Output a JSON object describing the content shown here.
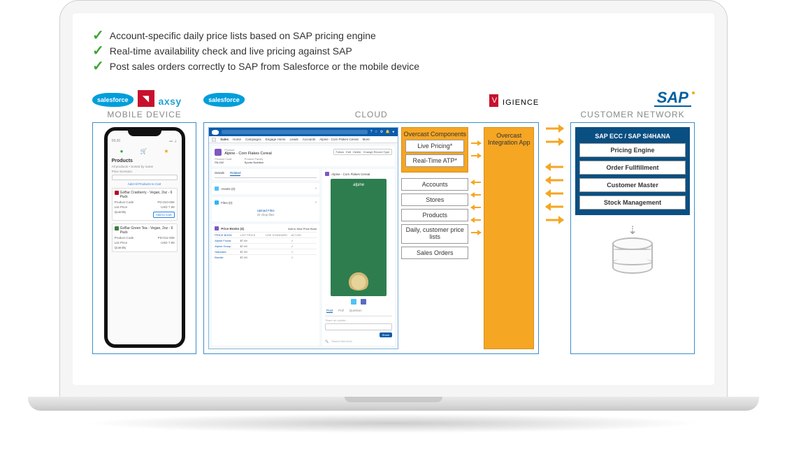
{
  "bullets": [
    "Account-specific daily price lists based on SAP pricing engine",
    "Real-time availability check and live pricing against SAP",
    "Post sales orders correctly to SAP from Salesforce or the mobile device"
  ],
  "brands": {
    "salesforce": "salesforce",
    "axsy": "axsy",
    "vigience_prefix": "V",
    "vigience_suffix": "IGIENCE",
    "sap": "SAP"
  },
  "sections": {
    "mobile": "MOBILE DEVICE",
    "cloud": "CLOUD",
    "customer": "CUSTOMER NETWORK"
  },
  "mobile": {
    "top_time": "09:30",
    "title": "Products",
    "subtitle": "All products • Sorted by name",
    "search_label": "Price Scenario",
    "add_link": "Add All Products to Cart",
    "item1": {
      "name": "GoBar Cranberry - Vegan, 2oz - 6 Pack",
      "code_label": "Product Code",
      "code": "PD-010-006",
      "price_label": "List Price",
      "price": "USD 7.99",
      "btn": "Add to Cart"
    },
    "item2": {
      "name": "GoBar Green Tea - Vegan, 2oz - 6 Pack",
      "code_label": "Product Code",
      "code": "PD-011-006",
      "price_label": "List Price",
      "price": "USD 7.99"
    },
    "qty": "Quantity"
  },
  "salesforce": {
    "nav": [
      "Sales",
      "Home",
      "Campaigns",
      "Engage Home",
      "Leads",
      "Accounts",
      "Alpine - Corn Flakes Cereal",
      "More"
    ],
    "record": {
      "label": "Product",
      "name": "Alpine - Corn Flakes Cereal",
      "kv1_label": "Product Code",
      "kv1": "PA-002",
      "kv2_label": "Product Family",
      "kv2": "Sports Nutrition",
      "action1": "Follow",
      "action2": "Edit",
      "action3": "Delete",
      "action4": "Change Record Type"
    },
    "tabs": [
      "Details",
      "Related"
    ],
    "assets": "Assets (0)",
    "files": "Files (0)",
    "upload_btn": "Upload Files",
    "upload_hint": "Or drop files",
    "pricebooks": {
      "title": "Price Books (4)",
      "headers": [
        "PRICE BOOK",
        "LIST PRICE",
        "USE STANDARD",
        "ACTIVE"
      ],
      "rows": [
        [
          "Alpine Foods",
          "$7.49",
          "",
          "✓"
        ],
        [
          "Alpine Group",
          "$7.49",
          "",
          "✓"
        ],
        [
          "Standard",
          "$7.49",
          "",
          "✓"
        ],
        [
          "Bundle",
          "$7.49",
          "",
          "✓"
        ]
      ],
      "action": "Add to New Price Book"
    },
    "right_title": "Alpine - Corn Flakes Cereal",
    "feed_tabs": [
      "Post",
      "Poll",
      "Question"
    ],
    "post_placeholder": "Share an update...",
    "share": "Share",
    "filter": "Search this feed..."
  },
  "overcast": {
    "components_title": "Overcast Components",
    "components": [
      "Live Pricing*",
      "Real-Time ATP*"
    ],
    "integration_title": "Overcast Integration App",
    "objects": [
      "Accounts",
      "Stores",
      "Products",
      "Daily, customer price lists",
      "Sales Orders"
    ]
  },
  "sap": {
    "title": "SAP ECC / SAP S/4HANA",
    "modules": [
      "Pricing Engine",
      "Order Fullfillment",
      "Customer Master",
      "Stock Management"
    ]
  }
}
